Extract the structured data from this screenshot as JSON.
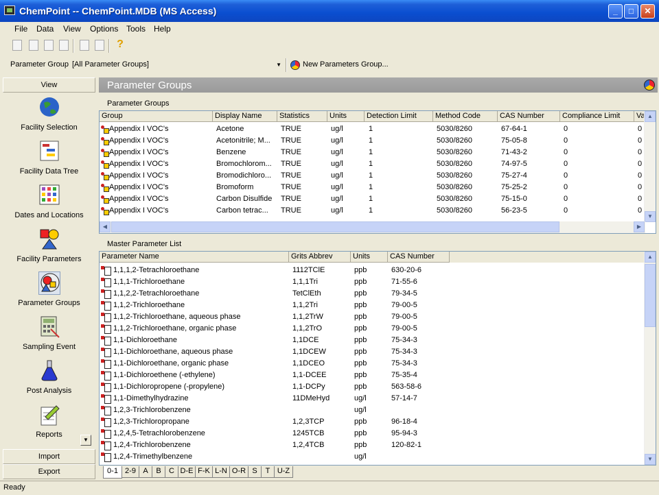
{
  "window": {
    "title": "ChemPoint -- ChemPoint.MDB (MS Access)",
    "min": "_",
    "max": "□",
    "close": "✕"
  },
  "menu": [
    "File",
    "Data",
    "View",
    "Options",
    "Tools",
    "Help"
  ],
  "toolbar": {
    "help_icon": "?"
  },
  "param_group_bar": {
    "label": "Parameter Group",
    "selected": "[All Parameter Groups]",
    "new_button": "New Parameters Group..."
  },
  "sidebar": {
    "view_label": "View",
    "items": [
      "Facility Selection",
      "Facility Data Tree",
      "Dates and Locations",
      "Facility Parameters",
      "Parameter Groups",
      "Sampling Event",
      "Post Analysis",
      "Reports"
    ],
    "import_label": "Import",
    "export_label": "Export"
  },
  "main": {
    "header": "Parameter Groups",
    "groups_label": "Parameter Groups",
    "groups_columns": [
      "Group",
      "Display Name",
      "Statistics",
      "Units",
      "Detection Limit",
      "Method Code",
      "CAS Number",
      "Compliance Limit",
      "Va"
    ],
    "groups_rows": [
      [
        "Appendix I VOC's",
        "Acetone",
        "TRUE",
        "ug/l",
        "1",
        "5030/8260",
        "67-64-1",
        "0",
        "0"
      ],
      [
        "Appendix I VOC's",
        "Acetonitrile; M...",
        "TRUE",
        "ug/l",
        "1",
        "5030/8260",
        "75-05-8",
        "0",
        "0"
      ],
      [
        "Appendix I VOC's",
        "Benzene",
        "TRUE",
        "ug/l",
        "1",
        "5030/8260",
        "71-43-2",
        "0",
        "0"
      ],
      [
        "Appendix I VOC's",
        "Bromochlorom...",
        "TRUE",
        "ug/l",
        "1",
        "5030/8260",
        "74-97-5",
        "0",
        "0"
      ],
      [
        "Appendix I VOC's",
        "Bromodichloro...",
        "TRUE",
        "ug/l",
        "1",
        "5030/8260",
        "75-27-4",
        "0",
        "0"
      ],
      [
        "Appendix I VOC's",
        "Bromoform",
        "TRUE",
        "ug/l",
        "1",
        "5030/8260",
        "75-25-2",
        "0",
        "0"
      ],
      [
        "Appendix I VOC's",
        "Carbon Disulfide",
        "TRUE",
        "ug/l",
        "1",
        "5030/8260",
        "75-15-0",
        "0",
        "0"
      ],
      [
        "Appendix I VOC's",
        "Carbon tetrac...",
        "TRUE",
        "ug/l",
        "1",
        "5030/8260",
        "56-23-5",
        "0",
        "0"
      ]
    ],
    "master_label": "Master Parameter List",
    "master_columns": [
      "Parameter Name",
      "Grits Abbrev",
      "Units",
      "CAS Number"
    ],
    "master_rows": [
      [
        "1,1,1,2-Tetrachloroethane",
        "1112TClE",
        "ppb",
        "630-20-6"
      ],
      [
        "1,1,1-Trichloroethane",
        "1,1,1Tri",
        "ppb",
        "71-55-6"
      ],
      [
        "1,1,2,2-Tetrachloroethane",
        "TetClEth",
        "ppb",
        "79-34-5"
      ],
      [
        "1,1,2-Trichloroethane",
        "1,1,2Tri",
        "ppb",
        "79-00-5"
      ],
      [
        "1,1,2-Trichloroethane, aqueous phase",
        "1,1,2TrW",
        "ppb",
        "79-00-5"
      ],
      [
        "1,1,2-Trichloroethane, organic phase",
        "1,1,2TrO",
        "ppb",
        "79-00-5"
      ],
      [
        "1,1-Dichloroethane",
        "1,1DCE",
        "ppb",
        "75-34-3"
      ],
      [
        "1,1-Dichloroethane, aqueous phase",
        "1,1DCEW",
        "ppb",
        "75-34-3"
      ],
      [
        "1,1-Dichloroethane, organic phase",
        "1,1DCEO",
        "ppb",
        "75-34-3"
      ],
      [
        "1,1-Dichloroethene (-ethylene)",
        "1,1-DCEE",
        "ppb",
        "75-35-4"
      ],
      [
        "1,1-Dichloropropene (-propylene)",
        "1,1-DCPy",
        "ppb",
        "563-58-6"
      ],
      [
        "1,1-Dimethylhydrazine",
        "11DMeHyd",
        "ug/l",
        "57-14-7"
      ],
      [
        "1,2,3-Trichlorobenzene",
        "",
        "ug/l",
        ""
      ],
      [
        "1,2,3-Trichloropropane",
        "1,2,3TCP",
        "ppb",
        "96-18-4"
      ],
      [
        "1,2,4,5-Tetrachlorobenzene",
        "1245TCB",
        "ppb",
        "95-94-3"
      ],
      [
        "1,2,4-Trichlorobenzene",
        "1,2,4TCB",
        "ppb",
        "120-82-1"
      ],
      [
        "1,2,4-Trimethylbenzene",
        "",
        "ug/l",
        ""
      ]
    ]
  },
  "tabs": [
    "0-1",
    "2-9",
    "A",
    "B",
    "C",
    "D-E",
    "F-K",
    "L-N",
    "O-R",
    "S",
    "T",
    "U-Z"
  ],
  "status": "Ready"
}
